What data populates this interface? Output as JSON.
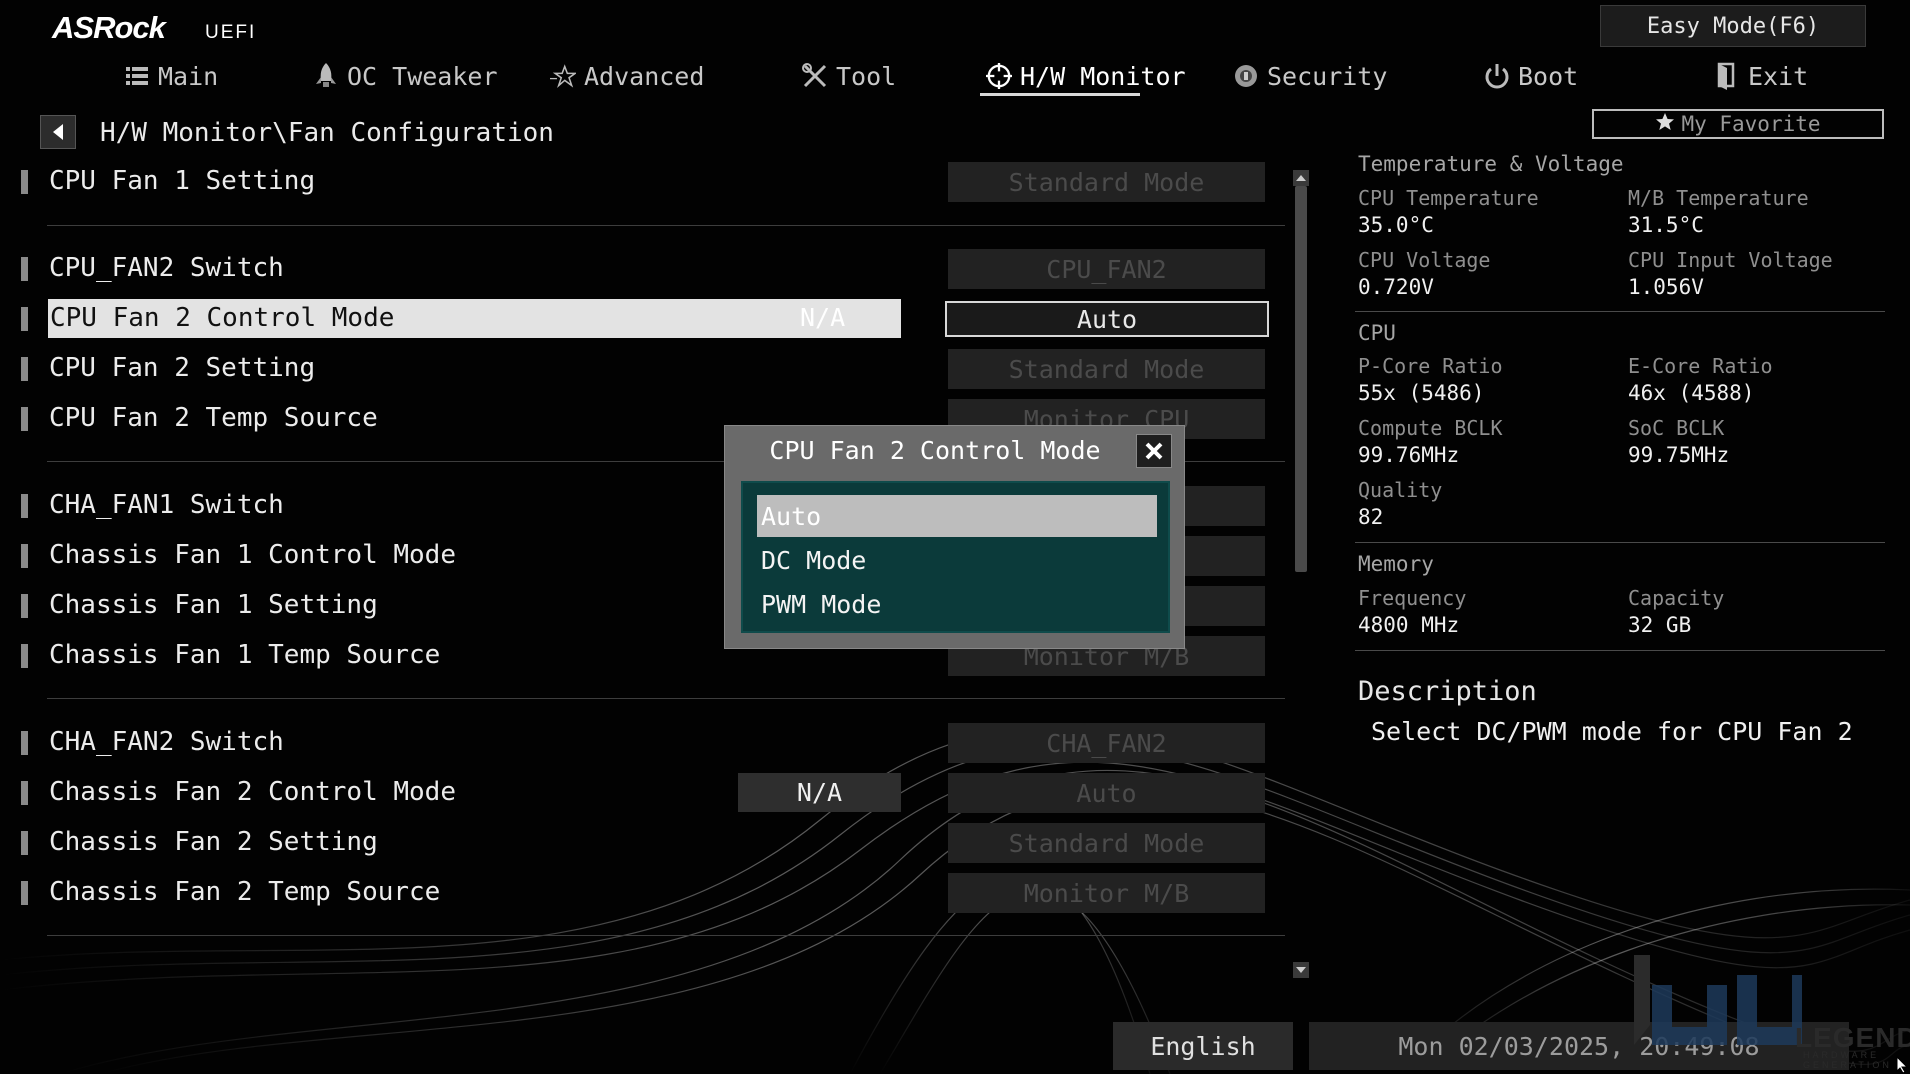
{
  "brand": {
    "logo": "ASRock",
    "sub": "UEFI"
  },
  "easy_mode_label": "Easy Mode(F6)",
  "tabs": [
    {
      "label": "Main",
      "icon": "list-icon"
    },
    {
      "label": "OC Tweaker",
      "icon": "rocket-icon"
    },
    {
      "label": "Advanced",
      "icon": "star-icon"
    },
    {
      "label": "Tool",
      "icon": "tools-icon"
    },
    {
      "label": "H/W Monitor",
      "icon": "monitor-icon",
      "active": true
    },
    {
      "label": "Security",
      "icon": "shield-icon"
    },
    {
      "label": "Boot",
      "icon": "power-icon"
    },
    {
      "label": "Exit",
      "icon": "exit-icon"
    }
  ],
  "breadcrumb": "H/W Monitor\\Fan Configuration",
  "favorite_label": "My Favorite",
  "settings": [
    {
      "label": "CPU Fan 1 Setting",
      "value": "Standard Mode"
    },
    {
      "label": "CPU_FAN2 Switch",
      "value": "CPU_FAN2"
    },
    {
      "label": "CPU Fan 2 Control Mode",
      "value": "Auto",
      "status": "N/A",
      "focused": true
    },
    {
      "label": "CPU Fan 2 Setting",
      "value": "Standard Mode"
    },
    {
      "label": "CPU Fan 2 Temp Source",
      "value": "Monitor CPU"
    },
    {
      "label": "CHA_FAN1 Switch",
      "value": ""
    },
    {
      "label": "Chassis Fan 1 Control Mode",
      "value": ""
    },
    {
      "label": "Chassis Fan 1 Setting",
      "value": ""
    },
    {
      "label": "Chassis Fan 1 Temp Source",
      "value": "Monitor M/B"
    },
    {
      "label": "CHA_FAN2 Switch",
      "value": "CHA_FAN2"
    },
    {
      "label": "Chassis Fan 2 Control Mode",
      "value": "Auto",
      "status": "N/A"
    },
    {
      "label": "Chassis Fan 2 Setting",
      "value": "Standard Mode"
    },
    {
      "label": "Chassis Fan 2 Temp Source",
      "value": "Monitor M/B"
    }
  ],
  "popup": {
    "title": "CPU Fan 2 Control Mode",
    "options": [
      "Auto",
      "DC Mode",
      "PWM Mode"
    ],
    "selected": "Auto"
  },
  "panel": {
    "temp_voltage": {
      "heading": "Temperature & Voltage",
      "cpu_temp_label": "CPU Temperature",
      "cpu_temp": "35.0°C",
      "mb_temp_label": "M/B Temperature",
      "mb_temp": "31.5°C",
      "cpu_volt_label": "CPU Voltage",
      "cpu_volt": "0.720V",
      "cpu_input_label": "CPU Input Voltage",
      "cpu_input": "1.056V"
    },
    "cpu": {
      "heading": "CPU",
      "pcore_label": "P-Core Ratio",
      "pcore": "55x (5486)",
      "ecore_label": "E-Core Ratio",
      "ecore": "46x (4588)",
      "compute_label": "Compute BCLK",
      "compute": "99.76MHz",
      "soc_label": "SoC BCLK",
      "soc": "99.75MHz",
      "quality_label": "Quality",
      "quality": "82"
    },
    "memory": {
      "heading": "Memory",
      "freq_label": "Frequency",
      "freq": "4800 MHz",
      "cap_label": "Capacity",
      "cap": "32 GB"
    },
    "description_title": "Description",
    "description": "Select DC/PWM mode for CPU Fan 2"
  },
  "footer": {
    "language": "English",
    "datetime": "Mon 02/03/2025, 20:49:08"
  },
  "watermark": {
    "text": "LEGEND",
    "sub": "HARDWARE GENERATION"
  }
}
